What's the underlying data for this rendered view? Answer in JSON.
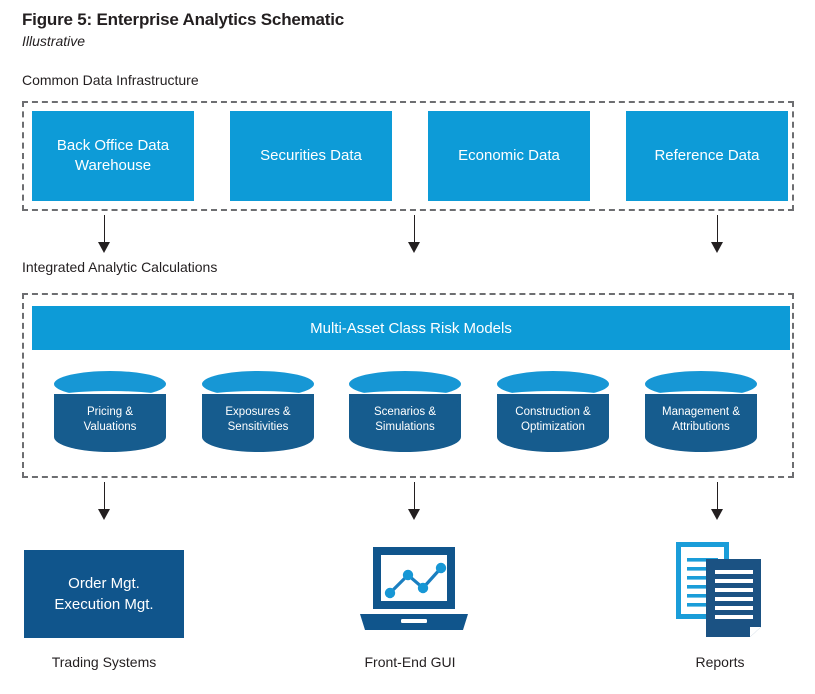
{
  "figure": {
    "title": "Figure 5: Enterprise Analytics Schematic",
    "subtitle": "Illustrative"
  },
  "sections": {
    "infrastructure_label": "Common Data Infrastructure",
    "analytics_label": "Integrated Analytic Calculations"
  },
  "infrastructure": {
    "boxes": [
      {
        "label": "Back Office Data Warehouse"
      },
      {
        "label": "Securities Data"
      },
      {
        "label": "Economic Data"
      },
      {
        "label": "Reference Data"
      }
    ]
  },
  "analytics": {
    "bar_label": "Multi-Asset Class Risk Models",
    "cylinders": [
      {
        "line1": "Pricing &",
        "line2": "Valuations"
      },
      {
        "line1": "Exposures &",
        "line2": "Sensitivities"
      },
      {
        "line1": "Scenarios &",
        "line2": "Simulations"
      },
      {
        "line1": "Construction &",
        "line2": "Optimization"
      },
      {
        "line1": "Management &",
        "line2": "Attributions"
      }
    ]
  },
  "outputs": {
    "trading": {
      "box_line1": "Order Mgt.",
      "box_line2": "Execution Mgt.",
      "caption": "Trading Systems"
    },
    "gui": {
      "caption": "Front-End GUI"
    },
    "reports": {
      "caption": "Reports"
    }
  },
  "colors": {
    "bright_blue": "#0d9bd7",
    "cylinder_top": "#1797d5",
    "cylinder_body": "#165c8e",
    "dark_blue": "#10558c",
    "arrow": "#231f20",
    "dashed_border": "#6d6e71",
    "text": "#231f20"
  }
}
